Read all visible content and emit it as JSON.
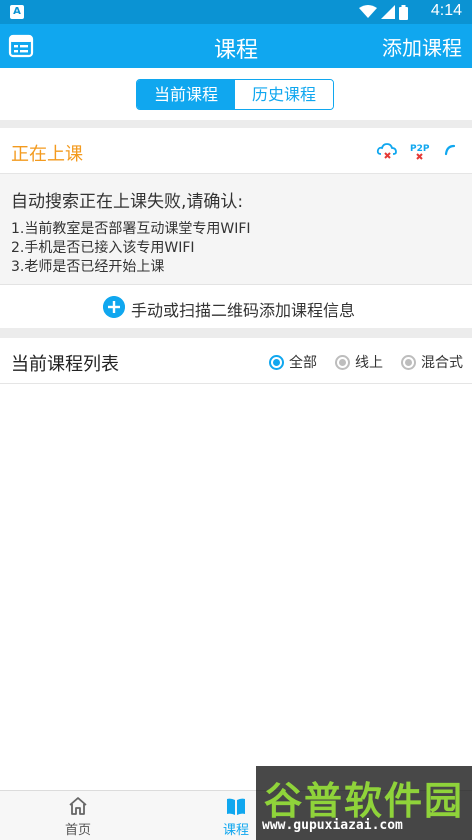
{
  "status_bar": {
    "notification_icon": "A",
    "time": "4:14",
    "icons": [
      "wifi-icon",
      "signal-icon",
      "battery-icon"
    ]
  },
  "app_bar": {
    "title": "课程",
    "action_label": "添加课程",
    "menu_icon": "list-icon"
  },
  "tabs": [
    {
      "label": "当前课程",
      "active": true
    },
    {
      "label": "历史课程",
      "active": false
    }
  ],
  "live_section": {
    "label": "正在上课",
    "icons": [
      "cloud-off-icon",
      "p2p-off-icon",
      "loading-spinner-icon"
    ]
  },
  "search_failure": {
    "heading": "自动搜索正在上课失败,请确认:",
    "items": [
      "1.当前教室是否部署互动课堂专用WIFI",
      "2.手机是否已接入该专用WIFI",
      "3.老师是否已经开始上课"
    ]
  },
  "add_course_row": {
    "label": "手动或扫描二维码添加课程信息"
  },
  "course_list": {
    "title": "当前课程列表",
    "filters": [
      {
        "label": "全部",
        "checked": true
      },
      {
        "label": "线上",
        "checked": false
      },
      {
        "label": "混合式",
        "checked": false
      }
    ]
  },
  "bottom_nav": [
    {
      "label": "首页",
      "active": false
    },
    {
      "label": "课程",
      "active": true
    }
  ],
  "watermark": {
    "title": "谷普软件园",
    "url": "www.gupuxiazai.com"
  },
  "colors": {
    "primary": "#10a7ef",
    "status_bar": "#0b93d3",
    "accent_orange": "#f39a1e",
    "watermark_green": "#8fd33a"
  }
}
